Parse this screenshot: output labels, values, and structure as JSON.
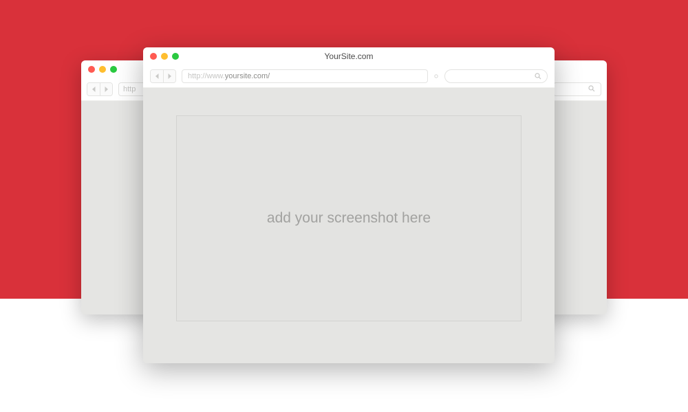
{
  "front": {
    "title": "YourSite.com",
    "url_prefix": "http://www.",
    "url_domain": "yoursite.com/",
    "placeholder": "add your screenshot here"
  },
  "back": {
    "url_visible": "http"
  },
  "colors": {
    "accent_bg": "#d9313a",
    "traffic_red": "#ff5a52",
    "traffic_yellow": "#ffbe2f",
    "traffic_green": "#2ac940"
  }
}
